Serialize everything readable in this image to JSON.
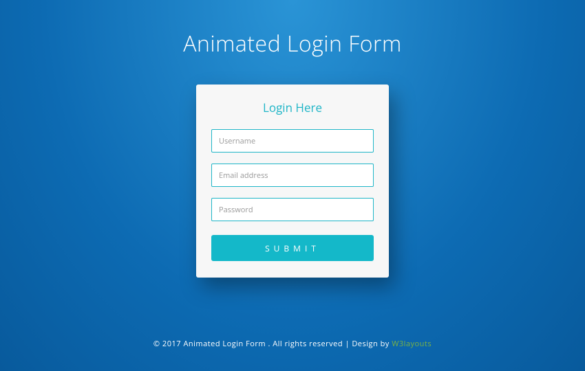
{
  "page": {
    "title": "Animated Login Form"
  },
  "card": {
    "header": "Login Here",
    "username_placeholder": "Username",
    "email_placeholder": "Email address",
    "password_placeholder": "Password",
    "submit_label": "SUBMIT"
  },
  "footer": {
    "text": "© 2017 Animated Login Form . All rights reserved | Design by ",
    "link_label": "W3layouts"
  },
  "colors": {
    "accent": "#14b8c9",
    "link": "#7cb342"
  }
}
